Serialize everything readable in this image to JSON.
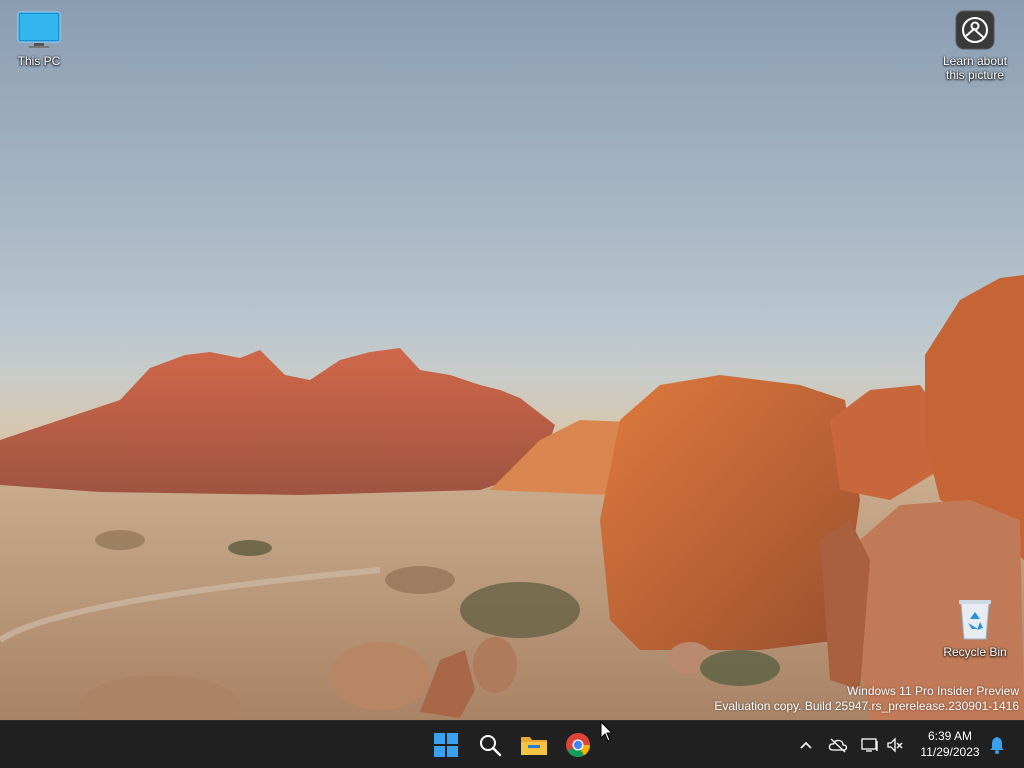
{
  "desktop": {
    "icons": [
      {
        "label": "This PC",
        "icon": "computer-monitor-icon"
      },
      {
        "label": "Learn about this picture",
        "icon": "camera-icon"
      },
      {
        "label": "Recycle Bin",
        "icon": "recycle-bin-icon"
      }
    ],
    "watermark": {
      "line1": "Windows 11 Pro Insider Preview",
      "line2": "Evaluation copy. Build 25947.rs_prerelease.230901-1416"
    }
  },
  "taskbar": {
    "apps": [
      {
        "name": "Start",
        "icon": "windows-start-icon"
      },
      {
        "name": "Search",
        "icon": "search-icon"
      },
      {
        "name": "File Explorer",
        "icon": "folder-icon"
      },
      {
        "name": "Google Chrome",
        "icon": "chrome-icon"
      }
    ],
    "tray": {
      "time": "6:39 AM",
      "date": "11/29/2023"
    }
  },
  "colors": {
    "taskbar_bg": "#202020",
    "start_blue": "#3aa0f0",
    "folder_yellow": "#f6c342"
  }
}
